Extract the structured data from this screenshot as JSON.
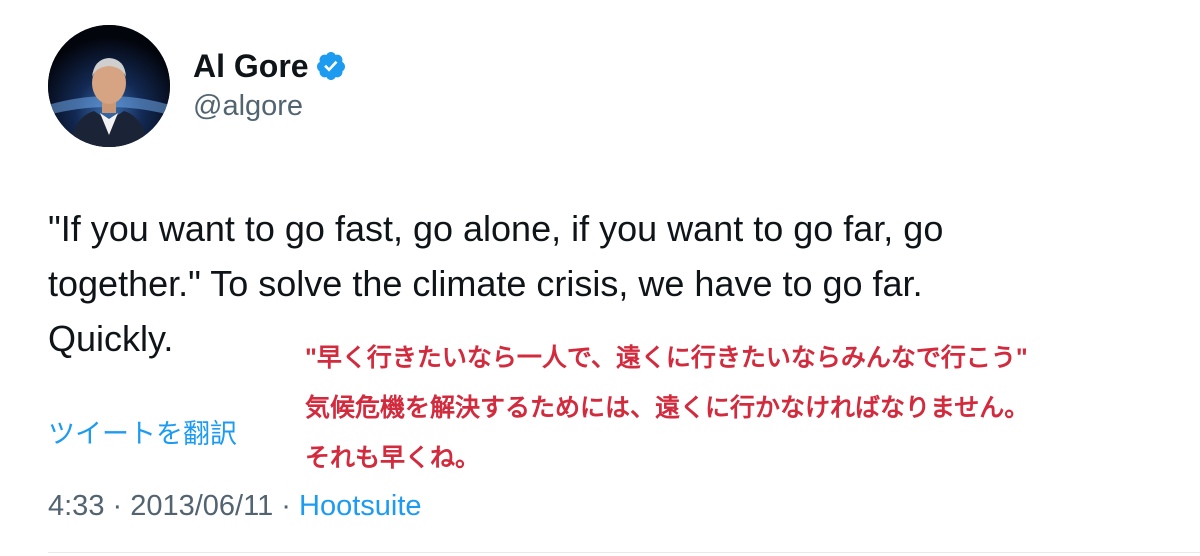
{
  "author": {
    "display_name": "Al Gore",
    "handle": "@algore",
    "verified_color": "#1d9bf0",
    "avatar_icon": "profile-photo"
  },
  "tweet": {
    "lines": [
      "\"If you want to go fast, go alone, if you want to go far, go",
      "together.\" To solve the climate crisis, we have to go far.",
      "Quickly."
    ],
    "translate_label": "ツイートを翻訳"
  },
  "overlay_translation": {
    "lines": [
      "\"早く行きたいなら一人で、遠くに行きたいならみんなで行こう\"",
      "気候危機を解決するためには、遠くに行かなければなりません。",
      "それも早くね。"
    ],
    "color": "#d22b3e"
  },
  "meta": {
    "time": "4:33",
    "separator": " · ",
    "date": "2013/06/11",
    "source": "Hootsuite"
  },
  "colors": {
    "text": "#0f1419",
    "secondary": "#536471",
    "link": "#1d9bf0"
  }
}
